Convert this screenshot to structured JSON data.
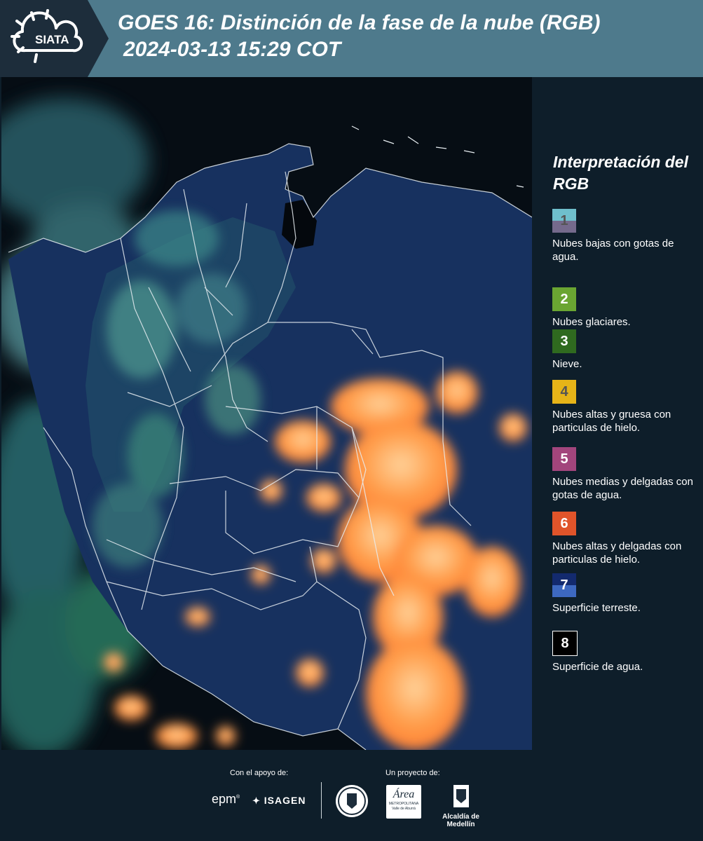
{
  "header": {
    "logo_text": "SIATA",
    "title_line1": "GOES 16: Distinción de la fase de la nube (RGB)",
    "title_line2": "2024-03-13 15:29 COT"
  },
  "legend": {
    "title": "Interpretación del RGB",
    "items": [
      {
        "number": "1",
        "label": "Nubes bajas con gotas de agua.",
        "colors": [
          "#6fbfcc",
          "#756a8c"
        ],
        "text_color": "#555555"
      },
      {
        "number": "2",
        "label": "Nubes glaciares.",
        "colors": [
          "#6aa532"
        ],
        "text_color": "#ffffff"
      },
      {
        "number": "3",
        "label": "Nieve.",
        "colors": [
          "#2f6a1f"
        ],
        "text_color": "#ffffff"
      },
      {
        "number": "4",
        "label": "Nubes altas y gruesa con particulas de hielo.",
        "colors": [
          "#e6b418"
        ],
        "text_color": "#555555"
      },
      {
        "number": "5",
        "label": "Nubes medias y delgadas con gotas de agua.",
        "colors": [
          "#a2457c"
        ],
        "text_color": "#ffffff"
      },
      {
        "number": "6",
        "label": "Nubes altas y delgadas con particulas de hielo.",
        "colors": [
          "#e0542a"
        ],
        "text_color": "#ffffff"
      },
      {
        "number": "7",
        "label": "Superficie terreste.",
        "colors": [
          "#132a6e",
          "#3d68c0"
        ],
        "text_color": "#ffffff"
      },
      {
        "number": "8",
        "label": "Superficie de agua.",
        "colors": [
          "#000000"
        ],
        "text_color": "#ffffff"
      }
    ]
  },
  "footer": {
    "support_label": "Con el apoyo de:",
    "project_label": "Un proyecto de:",
    "sponsor_epm": "epm",
    "sponsor_isagen": "ISAGEN",
    "area_metropolitana": "Área",
    "area_metropolitana_sub": "METROPOLITANA",
    "area_metropolitana_sub2": "Valle de Aburrá",
    "alcaldia": "Alcaldía de Medellín"
  },
  "colors": {
    "header_bg": "#4e7a8c",
    "page_bg": "#0e1e2a",
    "cloud_orange": "#ff9a45",
    "land_blue": "#1b2f66"
  }
}
